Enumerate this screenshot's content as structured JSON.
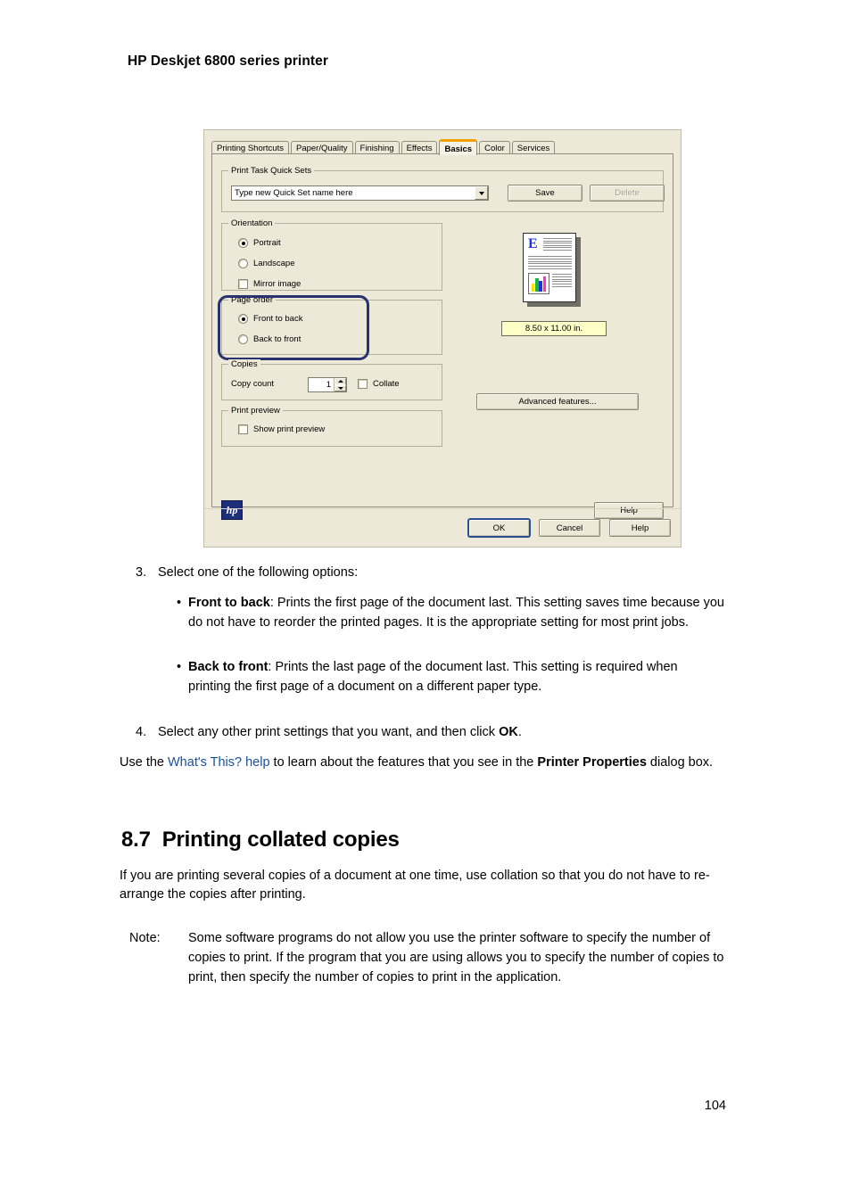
{
  "page": {
    "header": "HP Deskjet 6800 series printer",
    "page_number": "104"
  },
  "dialog": {
    "tabs": [
      {
        "label": "Printing Shortcuts",
        "selected": false
      },
      {
        "label": "Paper/Quality",
        "selected": false
      },
      {
        "label": "Finishing",
        "selected": false
      },
      {
        "label": "Effects",
        "selected": false
      },
      {
        "label": "Basics",
        "selected": true
      },
      {
        "label": "Color",
        "selected": false
      },
      {
        "label": "Services",
        "selected": false
      }
    ],
    "quick_sets": {
      "group_title": "Print Task Quick Sets",
      "combo_value": "Type new Quick Set name here",
      "save_label": "Save",
      "delete_label": "Delete"
    },
    "orientation": {
      "group_title": "Orientation",
      "portrait_label": "Portrait",
      "landscape_label": "Landscape",
      "mirror_label": "Mirror image",
      "selected": "Portrait",
      "mirror_checked": false
    },
    "page_order": {
      "group_title": "Page order",
      "front_to_back_label": "Front to back",
      "back_to_front_label": "Back to front",
      "selected": "Front to back",
      "highlight_color": "#27326e"
    },
    "copies": {
      "group_title": "Copies",
      "copy_count_label": "Copy count",
      "copy_count_value": "1",
      "collate_label": "Collate",
      "collate_checked": false
    },
    "print_preview": {
      "group_title": "Print preview",
      "show_label": "Show print preview",
      "checked": false
    },
    "preview": {
      "paper_size": "8.50 x 11.00 in.",
      "doc_letter": "E",
      "advanced_label": "Advanced features..."
    },
    "help_panel_label": "Help",
    "hp_logo_text": "hp",
    "buttons": {
      "ok": "OK",
      "cancel": "Cancel",
      "help": "Help"
    },
    "accent_color": "#f0a000",
    "face_color": "#ece9d8"
  },
  "content": {
    "step3": {
      "num": "3.",
      "text": "Select one of the following options:"
    },
    "bullets": [
      {
        "bold": "Front to back",
        "rest": ": Prints the first page of the document last. This setting saves time because you do not have to reorder the printed pages. It is the appropriate setting for most print jobs."
      },
      {
        "bold": "Back to front",
        "rest": ": Prints the last page of the document last. This setting is required when printing the first page of a document on a different paper type."
      }
    ],
    "step4": {
      "num": "4.",
      "pre": "Select any other print settings that you want, and then click ",
      "bold": "OK",
      "post": "."
    },
    "whats_this": {
      "pre": "Use the ",
      "link": "What's This? help",
      "mid": " to learn about the features that you see in the ",
      "bold": "Printer Properties",
      "post": " dialog box."
    },
    "section": {
      "number": "8.7",
      "title": "Printing collated copies",
      "paragraph": "If you are printing several copies of a document at one time, use collation so that you do not have to re-arrange the copies after printing."
    },
    "note": {
      "label": "Note:",
      "text": "Some software programs do not allow you use the printer software to specify the number of copies to print. If the program that you are using allows you to specify the number of copies to print, then specify the number of copies to print in the application."
    }
  }
}
